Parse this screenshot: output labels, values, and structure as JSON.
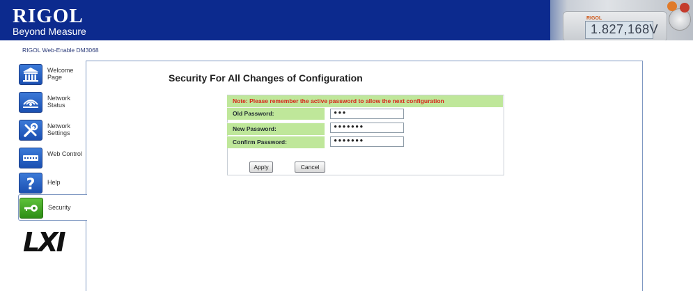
{
  "header": {
    "brand_name": "RIGOL",
    "brand_tagline": "Beyond Measure",
    "meter_logo": "RIGOL",
    "meter_reading": "1.827,168V"
  },
  "breadcrumb": "RIGOL Web-Enable DM3068",
  "sidebar": {
    "items": [
      {
        "label": "Welcome Page",
        "icon": "building-icon"
      },
      {
        "label": "Network Status",
        "icon": "network-status-icon"
      },
      {
        "label": "Network Settings",
        "icon": "tools-icon"
      },
      {
        "label": "Web Control",
        "icon": "keyboard-icon"
      },
      {
        "label": "Help",
        "icon": "question-icon"
      },
      {
        "label": "Security",
        "icon": "key-icon"
      }
    ],
    "active": "Security",
    "logo": "LXI"
  },
  "main": {
    "title": "Security For All Changes of Configuration",
    "note": "Note: Please remember the active password  to allow the next configuration",
    "fields": [
      {
        "label": "Old Password:",
        "value": "•••"
      },
      {
        "label": "New Password:",
        "value": "•••••••"
      },
      {
        "label": "Confirm Password:",
        "value": "•••••••"
      }
    ],
    "apply_label": "Apply",
    "cancel_label": "Cancel"
  },
  "colors": {
    "header_bg": "#0c2a8e",
    "note_bg": "#bfe79a",
    "note_text": "#d8251a",
    "panel_border": "#7f98c2"
  }
}
